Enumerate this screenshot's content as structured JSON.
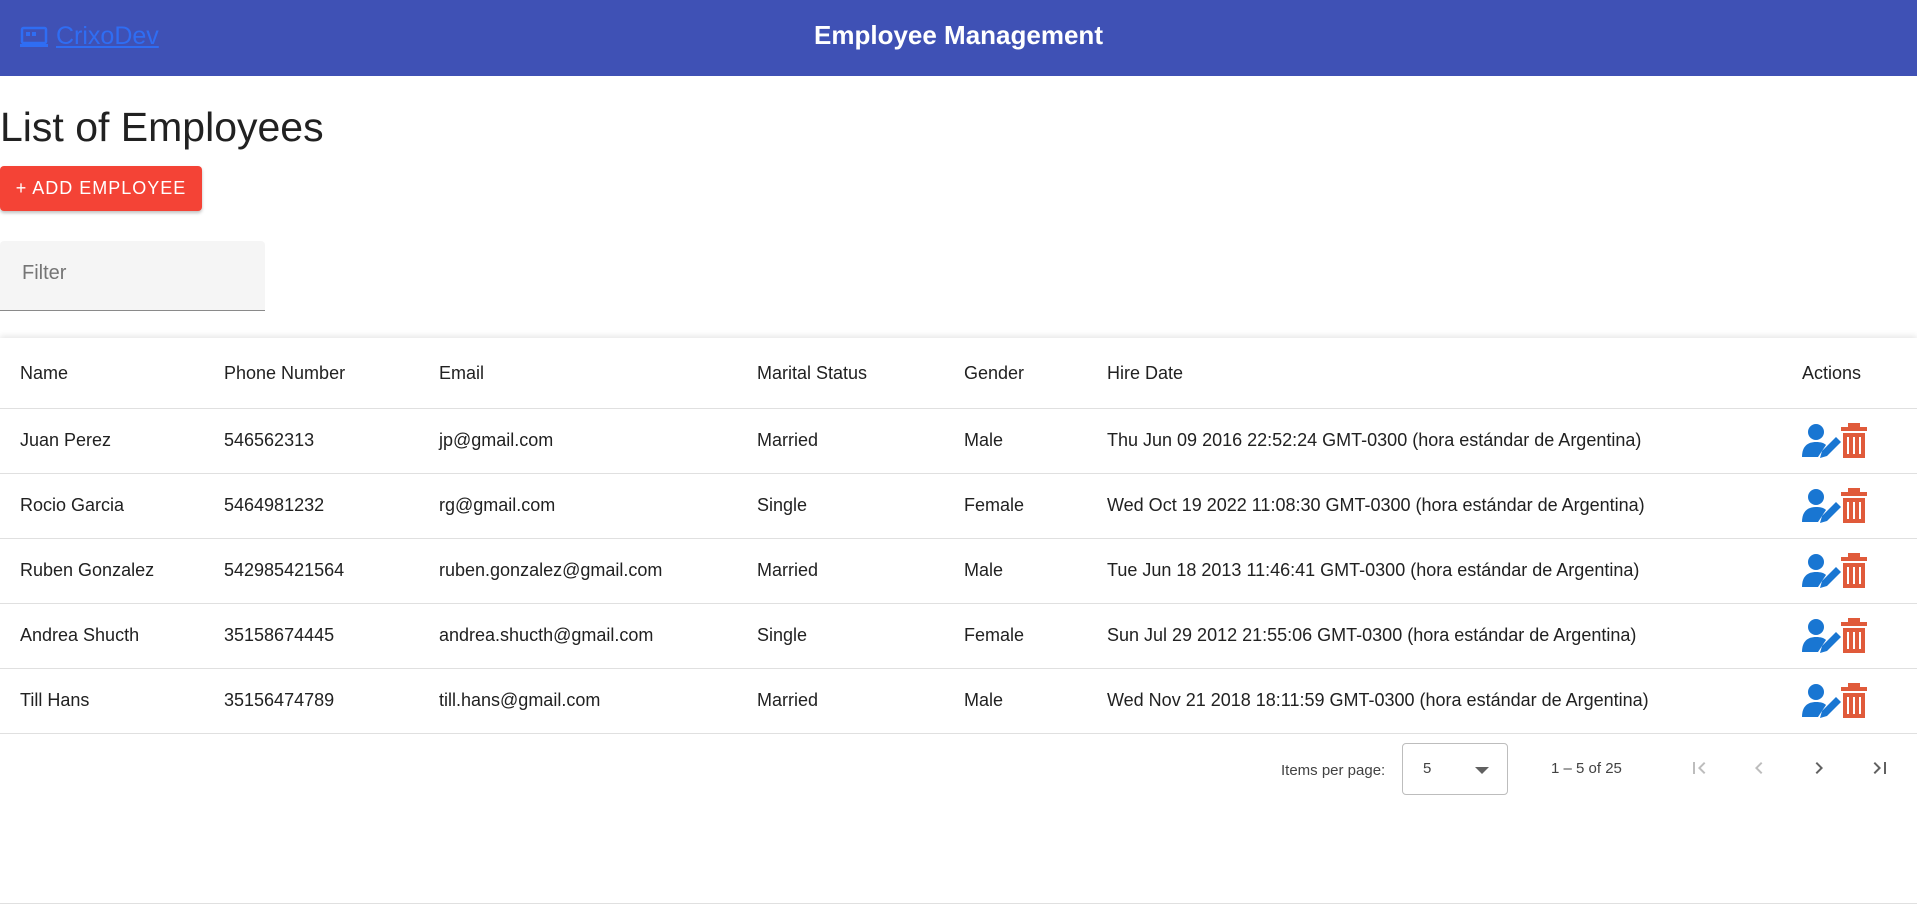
{
  "header": {
    "brand": "CrixoDev",
    "title": "Employee Management"
  },
  "page": {
    "heading": "List of Employees",
    "add_button": "+ ADD EMPLOYEE",
    "filter_placeholder": "Filter"
  },
  "table": {
    "columns": {
      "name": "Name",
      "phone": "Phone Number",
      "email": "Email",
      "marital": "Marital Status",
      "gender": "Gender",
      "hire": "Hire Date",
      "actions": "Actions"
    },
    "rows": [
      {
        "name": "Juan Perez",
        "phone": "546562313",
        "email": "jp@gmail.com",
        "marital": "Married",
        "gender": "Male",
        "hire": "Thu Jun 09 2016 22:52:24 GMT-0300 (hora estándar de Argentina)"
      },
      {
        "name": "Rocio Garcia",
        "phone": "5464981232",
        "email": "rg@gmail.com",
        "marital": "Single",
        "gender": "Female",
        "hire": "Wed Oct 19 2022 11:08:30 GMT-0300 (hora estándar de Argentina)"
      },
      {
        "name": "Ruben Gonzalez",
        "phone": "542985421564",
        "email": "ruben.gonzalez@gmail.com",
        "marital": "Married",
        "gender": "Male",
        "hire": "Tue Jun 18 2013 11:46:41 GMT-0300 (hora estándar de Argentina)"
      },
      {
        "name": "Andrea Shucth",
        "phone": "35158674445",
        "email": "andrea.shucth@gmail.com",
        "marital": "Single",
        "gender": "Female",
        "hire": "Sun Jul 29 2012 21:55:06 GMT-0300 (hora estándar de Argentina)"
      },
      {
        "name": "Till Hans",
        "phone": "35156474789",
        "email": "till.hans@gmail.com",
        "marital": "Married",
        "gender": "Male",
        "hire": "Wed Nov 21 2018 18:11:59 GMT-0300 (hora estándar de Argentina)"
      }
    ]
  },
  "paginator": {
    "items_per_page_label": "Items per page:",
    "page_size": "5",
    "range_label": "1 – 5 of 25"
  },
  "colors": {
    "toolbar": "#3f51b5",
    "brand_link": "#2f6df3",
    "add_button": "#f44336",
    "edit_icon": "#1976d2",
    "delete_icon": "#e05a3a"
  },
  "icons": {
    "brand": "computer-icon",
    "edit": "user-edit-icon",
    "delete": "trash-icon",
    "first_page": "first-page-icon",
    "prev_page": "chevron-left-icon",
    "next_page": "chevron-right-icon",
    "last_page": "last-page-icon"
  }
}
